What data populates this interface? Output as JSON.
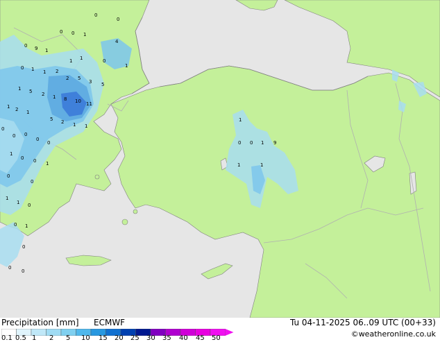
{
  "map": {
    "colors": {
      "sea": "#e6e6e6",
      "land": "#c4f09a",
      "border": "#b0b0b0",
      "coast": "#808080",
      "precip_light": "#a8ddf0",
      "precip_mid": "#7cc6ec",
      "precip_heavy": "#5aa8e0",
      "precip_strong": "#3a78d8"
    },
    "value_labels": [
      {
        "text": "0"
      },
      {
        "text": "0"
      },
      {
        "text": "0"
      },
      {
        "text": "0"
      },
      {
        "text": "1"
      },
      {
        "text": "0"
      },
      {
        "text": "9"
      },
      {
        "text": "1"
      },
      {
        "text": "0"
      },
      {
        "text": "1"
      },
      {
        "text": "1"
      },
      {
        "text": "2"
      },
      {
        "text": "4"
      },
      {
        "text": "0"
      },
      {
        "text": "1"
      },
      {
        "text": "1"
      },
      {
        "text": "1"
      },
      {
        "text": "2"
      },
      {
        "text": "5"
      },
      {
        "text": "3"
      },
      {
        "text": "5"
      },
      {
        "text": "1"
      },
      {
        "text": "5"
      },
      {
        "text": "2"
      },
      {
        "text": "1"
      },
      {
        "text": "8"
      },
      {
        "text": "10"
      },
      {
        "text": "11"
      },
      {
        "text": "1"
      },
      {
        "text": "2"
      },
      {
        "text": "1"
      },
      {
        "text": "5"
      },
      {
        "text": "2"
      },
      {
        "text": "1"
      },
      {
        "text": "1"
      },
      {
        "text": "0"
      },
      {
        "text": "0"
      },
      {
        "text": "0"
      },
      {
        "text": "0"
      },
      {
        "text": "0"
      },
      {
        "text": "1"
      },
      {
        "text": "0"
      },
      {
        "text": "0"
      },
      {
        "text": "1"
      },
      {
        "text": "0"
      },
      {
        "text": "0"
      },
      {
        "text": "1"
      },
      {
        "text": "1"
      },
      {
        "text": "0"
      },
      {
        "text": "0"
      },
      {
        "text": "1"
      },
      {
        "text": "0"
      },
      {
        "text": "0"
      },
      {
        "text": "0"
      },
      {
        "text": "1"
      },
      {
        "text": "0"
      },
      {
        "text": "0"
      },
      {
        "text": "1"
      },
      {
        "text": "9"
      },
      {
        "text": "1"
      },
      {
        "text": "1"
      }
    ]
  },
  "legend": {
    "title": "Precipitation [mm]",
    "model": "ECMWF",
    "datetime": "Tu 04-11-2025 06..09 UTC (00+33)",
    "credit": "©weatheronline.co.uk",
    "ticks": [
      "0.1",
      "0.5",
      "1",
      "2",
      "5",
      "10",
      "15",
      "20",
      "25",
      "30",
      "35",
      "40",
      "45",
      "50"
    ],
    "colors": [
      "#ffffff",
      "#e0f4fc",
      "#c0e8f8",
      "#a0dcf4",
      "#80d0f0",
      "#50b8ec",
      "#2898e0",
      "#1070d0",
      "#0040b0",
      "#001890",
      "#8000c0",
      "#b000d0",
      "#d000d8",
      "#e800e0",
      "#f010f0"
    ]
  }
}
